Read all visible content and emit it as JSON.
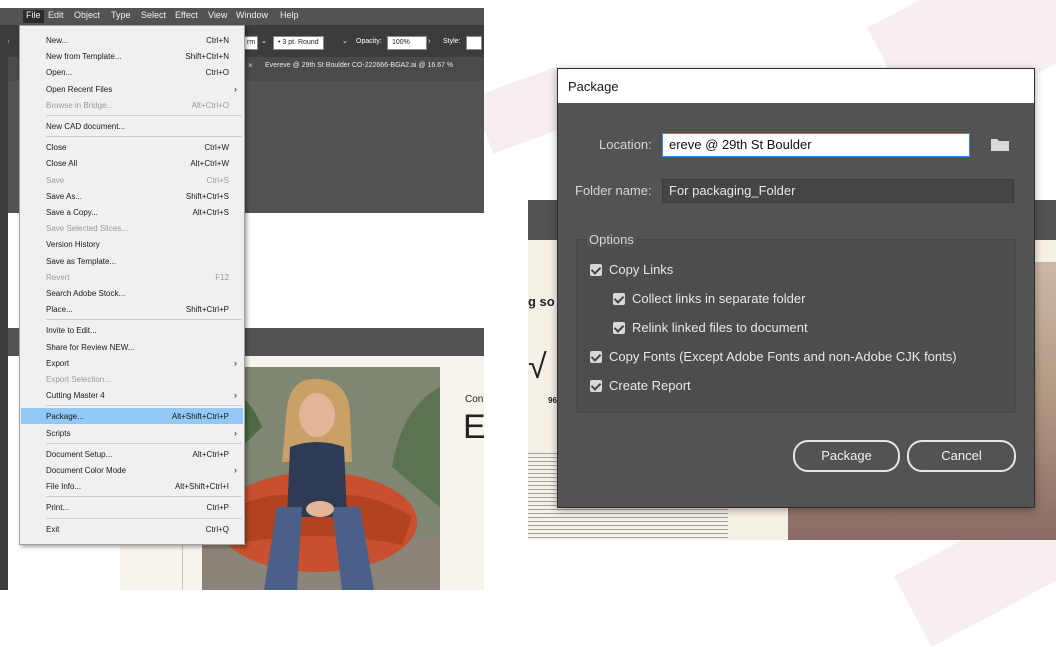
{
  "menubar": {
    "items": [
      "File",
      "Edit",
      "Object",
      "Type",
      "Select",
      "Effect",
      "View",
      "Window",
      "Help"
    ]
  },
  "control_bar": {
    "left_text": "on",
    "stroke_field": "rm",
    "brush": "3 pt. Round",
    "opacity_label": "Opacity:",
    "opacity_value": "100%",
    "style_label": "Style:"
  },
  "document_tab": {
    "title": "Evereve @ 29th St Boulder CO-222666-BGA2.ai @ 16.67 %",
    "close": "×"
  },
  "file_menu": {
    "items": [
      {
        "label": "New...",
        "shortcut": "Ctrl+N"
      },
      {
        "label": "New from Template...",
        "shortcut": "Shift+Ctrl+N"
      },
      {
        "label": "Open...",
        "shortcut": "Ctrl+O"
      },
      {
        "label": "Open Recent Files",
        "shortcut": "",
        "submenu": true
      },
      {
        "label": "Browse in Bridge...",
        "shortcut": "Alt+Ctrl+O",
        "disabled": true
      },
      {
        "label": "New CAD document...",
        "shortcut": ""
      },
      {
        "label": "Close",
        "shortcut": "Ctrl+W"
      },
      {
        "label": "Close All",
        "shortcut": "Alt+Ctrl+W"
      },
      {
        "label": "Save",
        "shortcut": "Ctrl+S",
        "disabled": true
      },
      {
        "label": "Save As...",
        "shortcut": "Shift+Ctrl+S"
      },
      {
        "label": "Save a Copy...",
        "shortcut": "Alt+Ctrl+S"
      },
      {
        "label": "Save Selected Slices...",
        "shortcut": "",
        "disabled": true
      },
      {
        "label": "Version History",
        "shortcut": ""
      },
      {
        "label": "Save as Template...",
        "shortcut": ""
      },
      {
        "label": "Revert",
        "shortcut": "F12",
        "disabled": true
      },
      {
        "label": "Search Adobe Stock...",
        "shortcut": ""
      },
      {
        "label": "Place...",
        "shortcut": "Shift+Ctrl+P"
      },
      {
        "label": "Invite to Edit...",
        "shortcut": ""
      },
      {
        "label": "Share for Review NEW...",
        "shortcut": ""
      },
      {
        "label": "Export",
        "shortcut": "",
        "submenu": true
      },
      {
        "label": "Export Selection...",
        "shortcut": "",
        "disabled": true
      },
      {
        "label": "Cutting Master 4",
        "shortcut": "",
        "submenu": true
      },
      {
        "label": "Package...",
        "shortcut": "Alt+Shift+Ctrl+P",
        "highlighted": true
      },
      {
        "label": "Scripts",
        "shortcut": "",
        "submenu": true
      },
      {
        "label": "Document Setup...",
        "shortcut": "Alt+Ctrl+P"
      },
      {
        "label": "Document Color Mode",
        "shortcut": "",
        "submenu": true
      },
      {
        "label": "File Info...",
        "shortcut": "Alt+Shift+Ctrl+I"
      },
      {
        "label": "Print...",
        "shortcut": "Ctrl+P"
      },
      {
        "label": "Exit",
        "shortcut": "Ctrl+Q"
      }
    ]
  },
  "artboard": {
    "right_text_1": "Con",
    "right_text_2": "E"
  },
  "right_doc": {
    "text_so": "g so",
    "check": "√",
    "num": "96"
  },
  "dialog": {
    "title": "Package",
    "location_label": "Location:",
    "location_value": "ereve @ 29th St Boulder",
    "folder_label": "Folder name:",
    "folder_value": "For packaging_Folder",
    "options_label": "Options",
    "options": [
      {
        "label": "Copy Links",
        "checked": true
      },
      {
        "label": "Collect links in separate folder",
        "checked": true
      },
      {
        "label": "Relink linked files to document",
        "checked": true
      },
      {
        "label": "Copy Fonts (Except Adobe Fonts and non-Adobe CJK fonts)",
        "checked": true
      },
      {
        "label": "Create Report",
        "checked": true
      }
    ],
    "package_button": "Package",
    "cancel_button": "Cancel"
  },
  "colors": {
    "menu_highlight": "#91c9f7",
    "dialog_bg": "#535353",
    "chair_orange": "#c8502e"
  }
}
